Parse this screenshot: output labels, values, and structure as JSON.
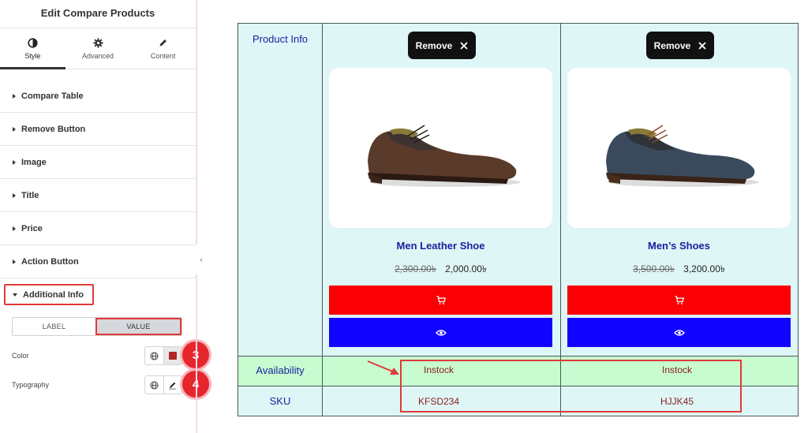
{
  "panel": {
    "title": "Edit Compare Products",
    "tabs": [
      {
        "label": "Style",
        "icon": "contrast-icon"
      },
      {
        "label": "Advanced",
        "icon": "gear-icon"
      },
      {
        "label": "Content",
        "icon": "pencil-icon"
      }
    ],
    "sections": [
      {
        "label": "Compare Table"
      },
      {
        "label": "Remove Button"
      },
      {
        "label": "Image"
      },
      {
        "label": "Title"
      },
      {
        "label": "Price"
      },
      {
        "label": "Action Button"
      },
      {
        "label": "Additional Info"
      }
    ],
    "segment": {
      "label": "LABEL",
      "value": "VALUE"
    },
    "color_label": "Color",
    "typography_label": "Typography",
    "swatch_color": "#b02525",
    "badges": [
      "3",
      "4"
    ]
  },
  "table": {
    "header_label": "Product Info",
    "availability_label": "Availability",
    "sku_label": "SKU",
    "products": [
      {
        "remove_label": "Remove",
        "title": "Men Leather Shoe",
        "old_price": "2,300.00৳",
        "new_price": "2,000.00৳",
        "availability": "Instock",
        "sku": "KFSD234",
        "shoe_color": "#5a3a2a"
      },
      {
        "remove_label": "Remove",
        "title": "Men’s Shoes",
        "old_price": "3,500.00৳",
        "new_price": "3,200.00৳",
        "availability": "Instock",
        "sku": "HJJK45",
        "shoe_color": "#3a4a5c"
      }
    ],
    "colors": {
      "cell_bg": "#dff6f6",
      "row_bg": "#c8fcd0",
      "cart_bg": "#fa0004",
      "view_bg": "#1205ff",
      "label_color": "#1a1f9c",
      "value_color": "#8a1c1c"
    }
  }
}
